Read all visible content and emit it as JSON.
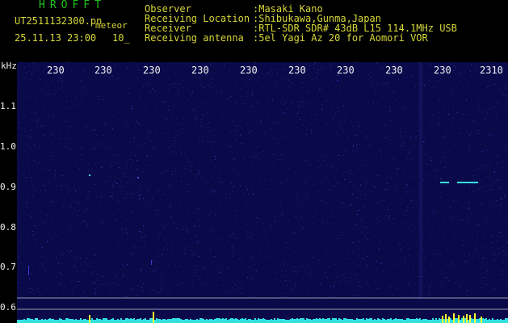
{
  "header": {
    "program": "HROFFT",
    "filename": "UT2511132300.pn",
    "meteor_label": "meteor",
    "datetime": "25.11.13 23:00",
    "count": "10_"
  },
  "info": [
    {
      "label": "Observer",
      "value": ":Masaki Kano"
    },
    {
      "label": "Receiving Location",
      "value": ":Shibukawa,Gunma,Japan"
    },
    {
      "label": "Receiver",
      "value": ":RTL-SDR SDR# 43dB L15 114.1MHz USB"
    },
    {
      "label": "Receiving antenna",
      "value": ":5el Yagi Az 20 for Aomori VOR"
    }
  ],
  "spectrogram": {
    "y_unit": "kHz",
    "y_ticks": [
      "1.1",
      "1.0",
      "0.9",
      "0.8",
      "0.7",
      "0.6"
    ],
    "x_ticks": [
      "230",
      "230",
      "230",
      "230",
      "230",
      "230",
      "230",
      "230",
      "230",
      "2310"
    ],
    "background_color": "#0a0a4a",
    "signal_color": "#33e0e0",
    "marker_color": "#ffff33"
  }
}
